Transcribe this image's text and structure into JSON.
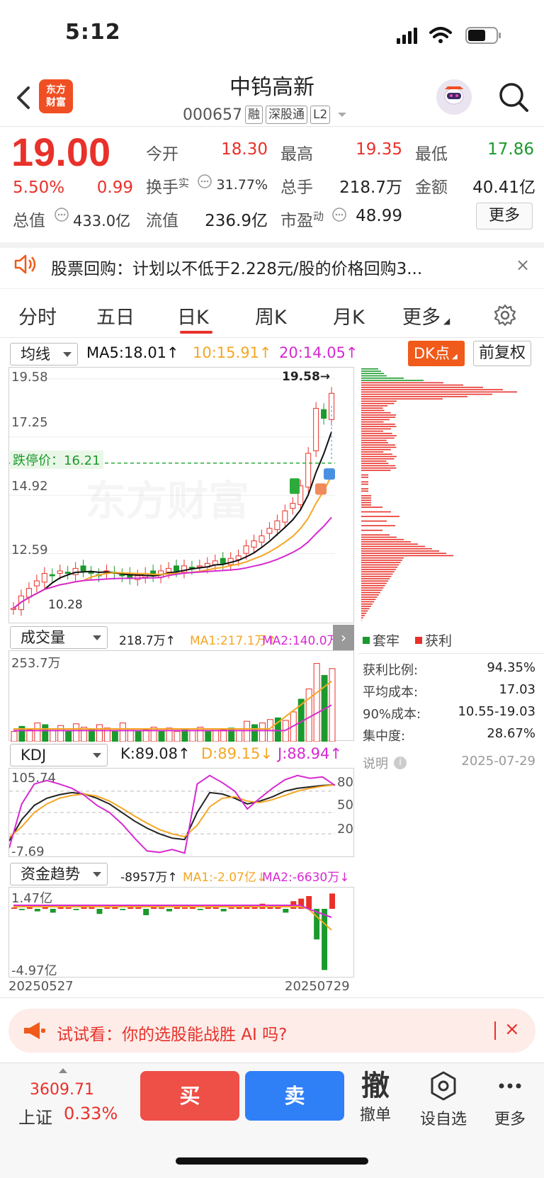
{
  "status": {
    "time": "5:12"
  },
  "header": {
    "brand_line1": "东方",
    "brand_line2": "财富",
    "name": "中钨高新",
    "code": "000657",
    "tags": [
      "融",
      "深股通",
      "L2"
    ]
  },
  "quote": {
    "price": "19.00",
    "pct": "5.50%",
    "chg": "0.99",
    "mcap_label": "总值",
    "mcap_value": "433.0亿",
    "open_label": "今开",
    "open": "18.30",
    "high_label": "最高",
    "high": "19.35",
    "low_label": "最低",
    "low": "17.86",
    "turnover_label": "换手",
    "turnover_sup": "实",
    "turnover": "31.77%",
    "volume_label": "总手",
    "volume": "218.7万",
    "amount_label": "金额",
    "amount": "40.41亿",
    "float_label": "流值",
    "float": "236.9亿",
    "pe_label": "市盈",
    "pe_sup": "动",
    "pe": "48.99",
    "more": "更多"
  },
  "news": {
    "text": "股票回购：计划以不低于2.228元/股的价格回购3...",
    "close": "×"
  },
  "tabs": [
    "分时",
    "五日",
    "日K",
    "周K",
    "月K",
    "更多"
  ],
  "active_tab": "日K",
  "kline": {
    "indicator": "均线",
    "ma5": "MA5:18.01↑",
    "ma10": "10:15.91↑",
    "ma20": "20:14.05↑",
    "dk": "DK点",
    "fuquan": "前复权",
    "y_labels": [
      "19.58",
      "17.25",
      "14.92",
      "12.59"
    ],
    "peak_label": "19.58→",
    "limit_down": "跌停价：16.21",
    "low_label": "10.28",
    "watermark": "东方财富"
  },
  "volume": {
    "indicator": "成交量",
    "value": "218.7万↑",
    "ma1": "MA1:217.1万↑",
    "ma2": "MA2:140.0万",
    "y_max": "253.7万"
  },
  "kdj": {
    "indicator": "KDJ",
    "k": "K:89.08↑",
    "d": "D:89.15↓",
    "j": "J:88.94↑",
    "y_max": "105.74",
    "y_min": "-7.69",
    "levels": [
      "80",
      "50",
      "20"
    ]
  },
  "fund": {
    "indicator": "资金趋势",
    "value": "-8957万↑",
    "ma1": "MA1:-2.07亿↓",
    "ma2": "MA2:-6630万↓",
    "y_max": "1.47亿",
    "y_min": "-4.97亿",
    "date_start": "20250527",
    "date_end": "20250729"
  },
  "chips": {
    "legend_trapped": "套牢",
    "legend_profit": "获利",
    "stats": [
      {
        "label": "获利比例:",
        "value": "94.35%"
      },
      {
        "label": "平均成本:",
        "value": "17.03"
      },
      {
        "label": "90%成本:",
        "value": "10.55-19.03"
      },
      {
        "label": "集中度:",
        "value": "28.67%"
      }
    ],
    "note": "说明",
    "date": "2025-07-29"
  },
  "promo": {
    "text": "试试看：你的选股能战胜 AI 吗?",
    "close": "×"
  },
  "bottom": {
    "index_value": "3609.71",
    "index_name": "上证",
    "index_pct": "0.33%",
    "buy": "买",
    "sell": "卖",
    "cancel_glyph": "撤",
    "cancel": "撤单",
    "watch": "设自选",
    "more": "更多"
  },
  "colors": {
    "up": "#e8312a",
    "down": "#1a9a2c",
    "ma5": "#111111",
    "ma10": "#f5a623",
    "ma20": "#d62ad0",
    "accent": "#f05a1a"
  }
}
